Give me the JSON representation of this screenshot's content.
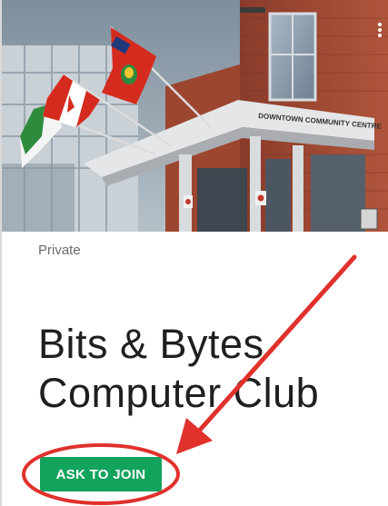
{
  "group": {
    "privacy": "Private",
    "title_line1": "Bits & Bytes",
    "title_line2": "Computer Club",
    "join_label": "ASK TO JOIN"
  },
  "cover": {
    "sign_text": "DOWNTOWN COMMUNITY CENTRE",
    "icon": "more-vert-icon"
  },
  "annotation": {
    "color": "#e0312c"
  },
  "colors": {
    "join_button": "#12a35d",
    "title_text": "#1f1f1f",
    "privacy_text": "#6b6b6b"
  }
}
